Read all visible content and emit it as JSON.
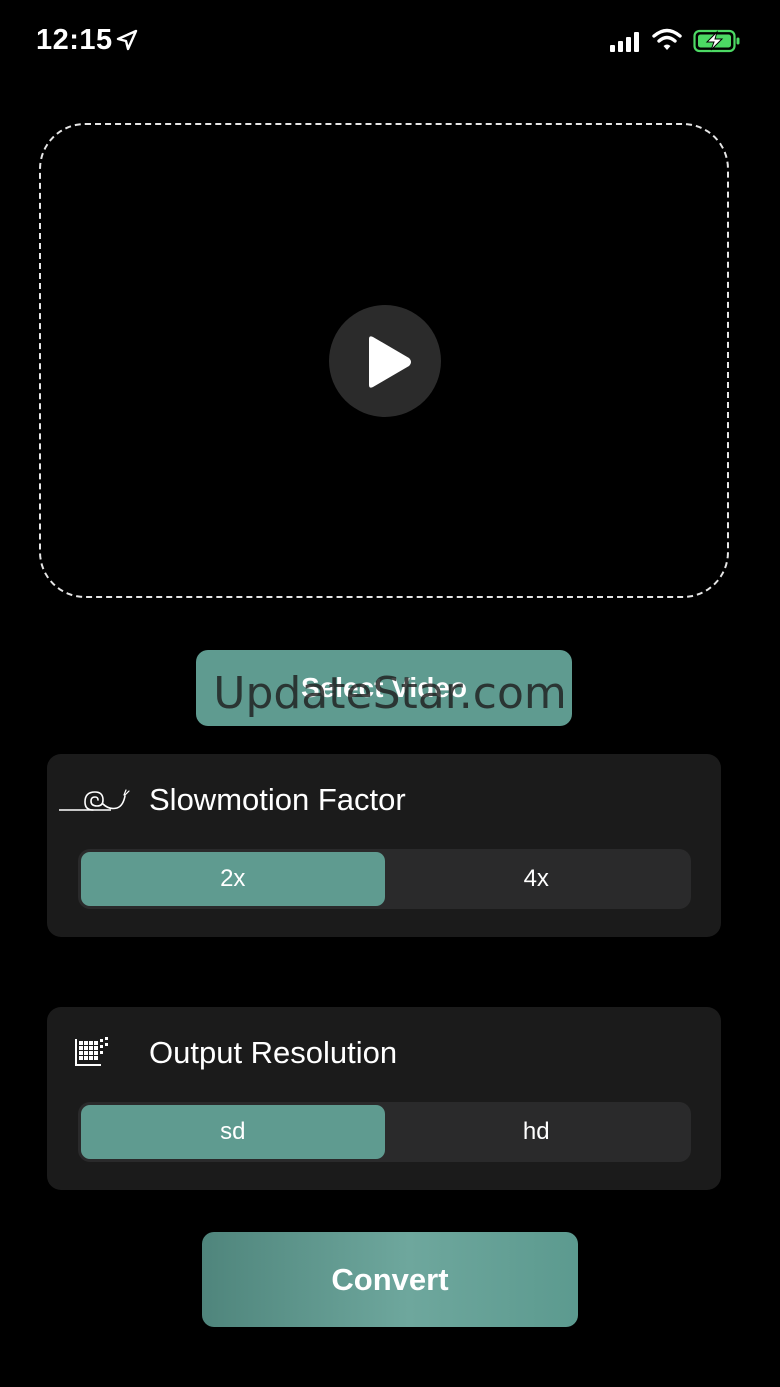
{
  "status_bar": {
    "time": "12:15",
    "icons": [
      "location-arrow-icon",
      "cellular-signal-icon",
      "wifi-icon",
      "battery-charging-icon"
    ],
    "battery_color": "#4cd964"
  },
  "video_area": {
    "icon": "play-icon"
  },
  "select_video": {
    "label": "Select Video"
  },
  "watermark": "UpdateStar.com",
  "slowmotion": {
    "title": "Slowmotion Factor",
    "icon": "snail-icon",
    "options": [
      "2x",
      "4x"
    ],
    "selected": "2x"
  },
  "resolution": {
    "title": "Output Resolution",
    "icon": "pixel-grid-icon",
    "options": [
      "sd",
      "hd"
    ],
    "selected": "sd"
  },
  "convert": {
    "label": "Convert"
  },
  "colors": {
    "accent": "#5f9b90",
    "card": "#1b1b1b",
    "segment_bg": "#2a2a2b",
    "background": "#000000"
  }
}
